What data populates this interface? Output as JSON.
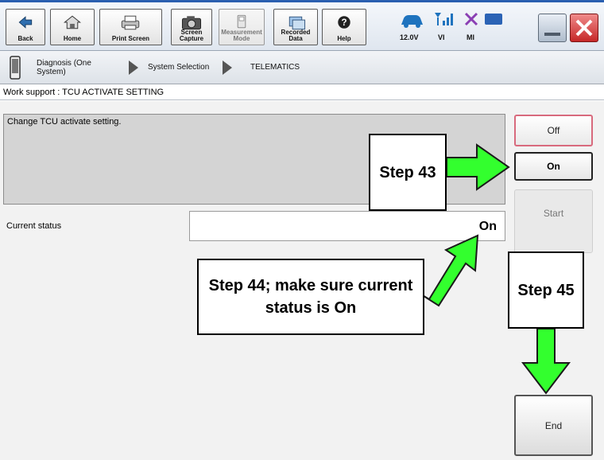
{
  "toolbar": {
    "buttons": [
      {
        "label": "Back"
      },
      {
        "label": "Home"
      },
      {
        "label": "Print Screen"
      },
      {
        "label": "Screen Capture"
      },
      {
        "label": "Measurement Mode"
      },
      {
        "label": "Recorded Data"
      },
      {
        "label": "Help"
      }
    ],
    "status": {
      "voltage": "12.0V",
      "vi": "VI",
      "mi": "MI"
    }
  },
  "breadcrumb": {
    "item1": "Diagnosis (One System)",
    "item2": "System Selection",
    "item3": "TELEMATICS"
  },
  "work_support": {
    "title": "Work support : TCU ACTIVATE SETTING",
    "description": "Change TCU activate setting.",
    "current_status_label": "Current status",
    "current_status_value": "On"
  },
  "side_buttons": {
    "off": "Off",
    "on": "On",
    "start": "Start",
    "end": "End"
  },
  "callouts": {
    "step43": "Step 43",
    "step44": "Step 44; make sure current status is On",
    "step45": "Step 45"
  },
  "colors": {
    "arrow_fill": "#33ff2e",
    "accent_blue": "#2a5fb0",
    "close_red": "#d32f2f"
  }
}
